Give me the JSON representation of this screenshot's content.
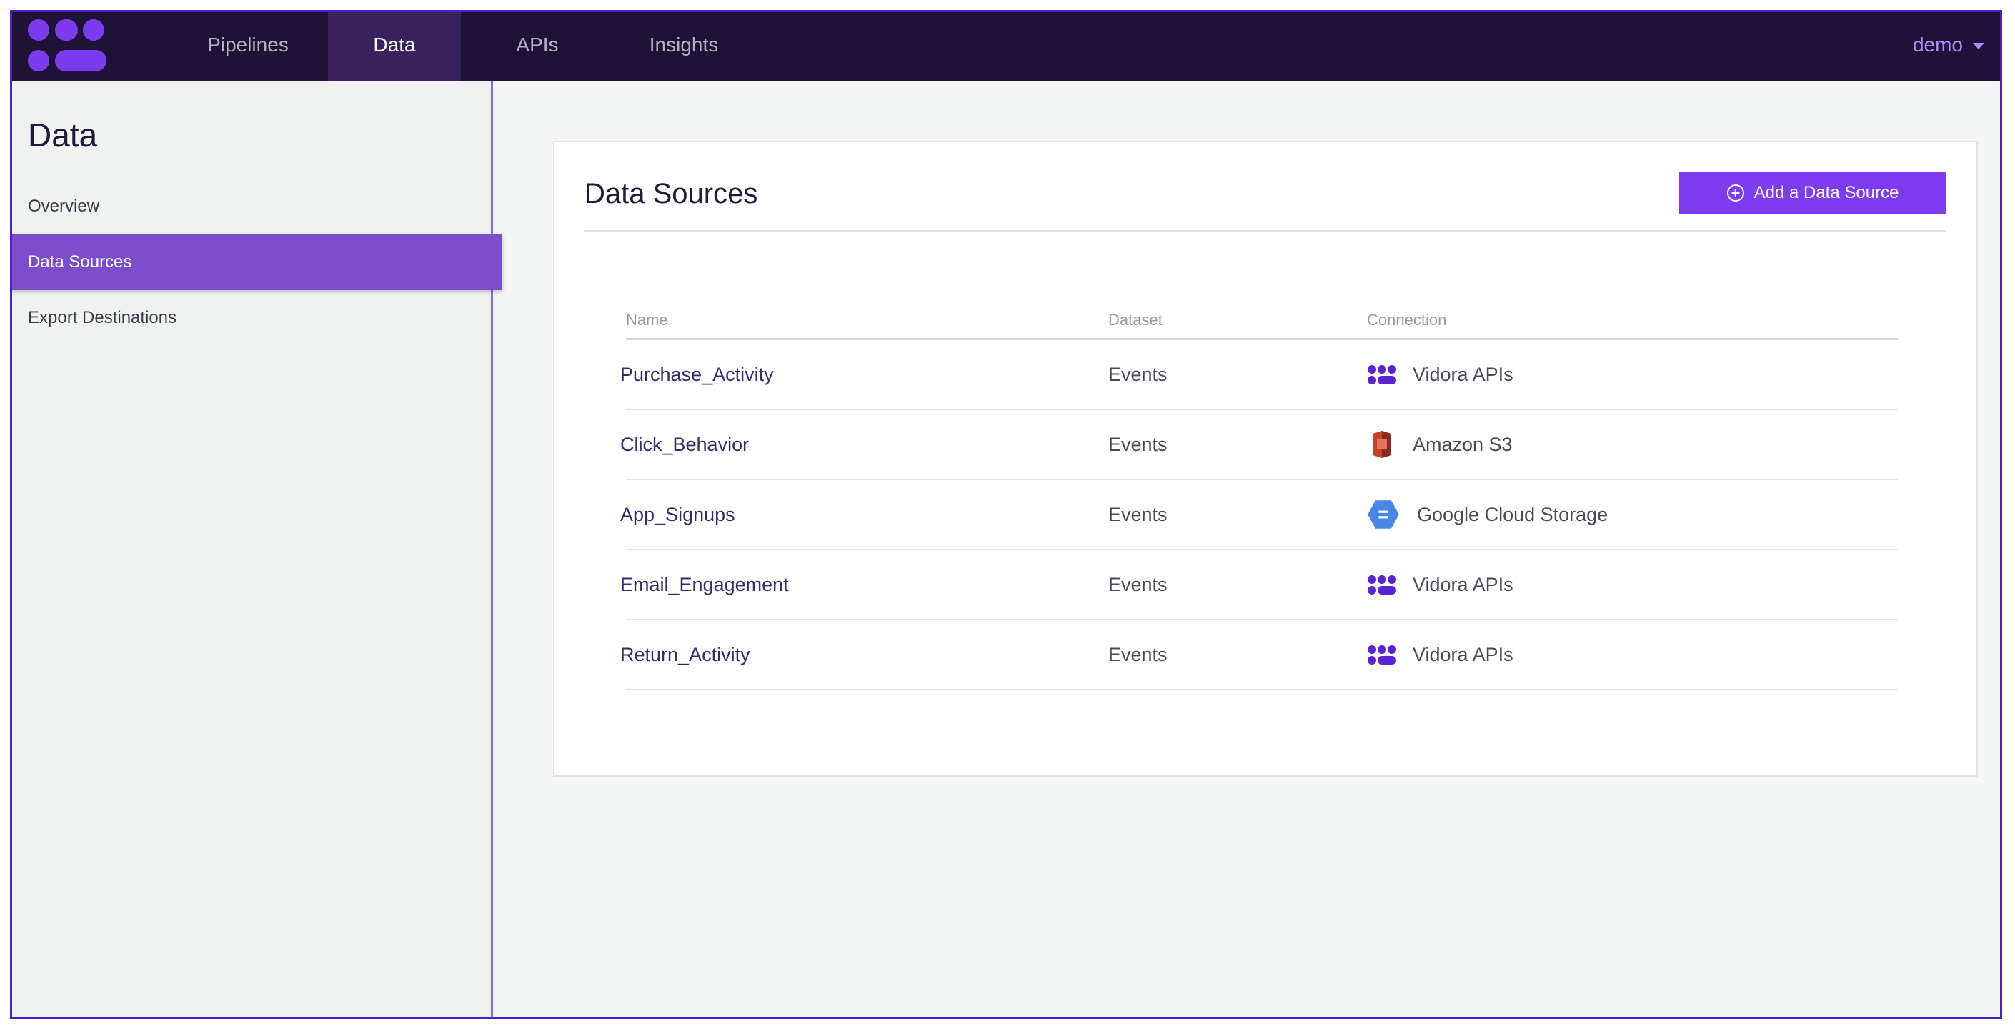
{
  "nav": {
    "items": [
      {
        "label": "Pipelines",
        "active": false
      },
      {
        "label": "Data",
        "active": true
      },
      {
        "label": "APIs",
        "active": false
      },
      {
        "label": "Insights",
        "active": false
      }
    ],
    "user": "demo",
    "colors": {
      "bar": "#1e1236",
      "active": "#3a2160",
      "accent": "#b08cff"
    }
  },
  "sidebar": {
    "title": "Data",
    "items": [
      {
        "label": "Overview",
        "active": false
      },
      {
        "label": "Data Sources",
        "active": true
      },
      {
        "label": "Export Destinations",
        "active": false
      }
    ]
  },
  "main": {
    "title": "Data Sources",
    "add_button": "Add a Data Source",
    "table": {
      "columns": [
        "Name",
        "Dataset",
        "Connection"
      ],
      "rows": [
        {
          "name": "Purchase_Activity",
          "dataset": "Events",
          "connection": "Vidora APIs",
          "icon": "vidora-logo-icon"
        },
        {
          "name": "Click_Behavior",
          "dataset": "Events",
          "connection": "Amazon S3",
          "icon": "amazon-s3-icon"
        },
        {
          "name": "App_Signups",
          "dataset": "Events",
          "connection": "Google Cloud Storage",
          "icon": "google-cloud-storage-icon"
        },
        {
          "name": "Email_Engagement",
          "dataset": "Events",
          "connection": "Vidora APIs",
          "icon": "vidora-logo-icon"
        },
        {
          "name": "Return_Activity",
          "dataset": "Events",
          "connection": "Vidora APIs",
          "icon": "vidora-logo-icon"
        }
      ]
    }
  }
}
